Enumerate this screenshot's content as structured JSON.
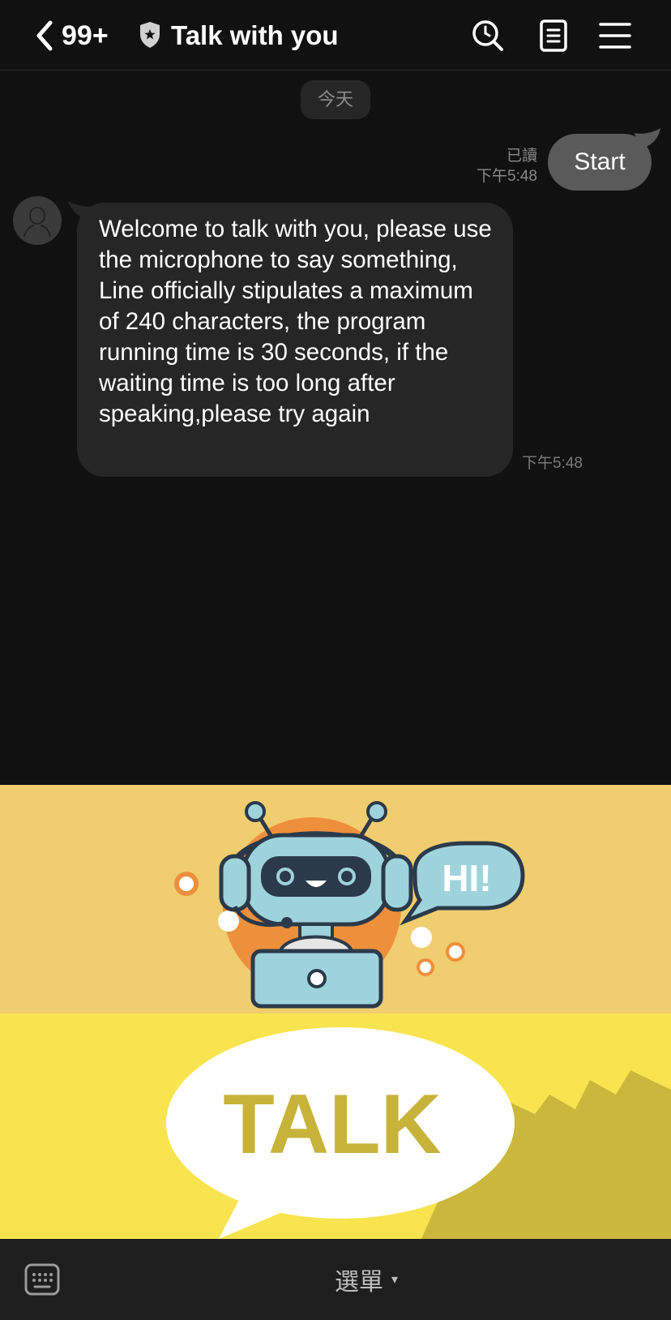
{
  "header": {
    "unread_count": "99+",
    "title": "Talk with you",
    "icons": [
      "back-chevron-icon",
      "shield-star-icon",
      "history-search-icon",
      "notes-icon",
      "hamburger-menu-icon"
    ]
  },
  "chat": {
    "date_label": "今天",
    "outgoing": {
      "text": "Start",
      "read_status": "已讀",
      "time": "下午5:48"
    },
    "incoming": {
      "text": "Welcome to talk with you, please use the microphone to say something, Line officially stipulates a maximum of 240 characters, the program running time is 30 seconds, if the waiting time is too long after speaking,please try again",
      "time": "下午5:48"
    }
  },
  "rich_menu": {
    "top_panel": {
      "speech_text": "HI!"
    },
    "bottom_panel": {
      "label": "TALK"
    }
  },
  "bottom_bar": {
    "menu_label": "選單",
    "caret": "▾"
  },
  "colors": {
    "background": "#111112",
    "bubble_in": "#262627",
    "bubble_out": "#5a5a5a",
    "rich_top": "#f0cd6f",
    "rich_bottom": "#f8e44f",
    "talk_text": "#c7b33a"
  }
}
